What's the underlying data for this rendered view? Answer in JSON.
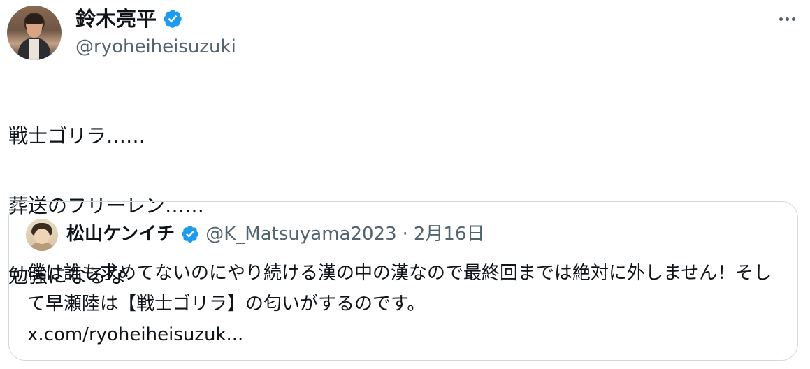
{
  "author": {
    "display_name": "鈴木亮平",
    "handle": "@ryoheiheisuzuki",
    "verified": true
  },
  "tweet": {
    "text_lines": [
      "戦士ゴリラ……",
      "葬送のフリーレン……",
      "勉強になるな"
    ]
  },
  "quoted_tweet": {
    "display_name": "松山ケンイチ",
    "verified": true,
    "handle": "@K_Matsuyama2023",
    "separator": "·",
    "date": "2月16日",
    "text": "僕は誰も求めてないのにやり続ける漢の中の漢なので最終回までは絶対に外しません！そして早瀬陸は【戦士ゴリラ】の匂いがするのです。",
    "link": "x.com/ryoheiheisuzuk..."
  },
  "icons": {
    "verified": "verified-badge-icon",
    "more": "more-horizontal-icon"
  },
  "colors": {
    "verified_blue": "#1d9bf0",
    "secondary_text": "#536471",
    "border": "#cfd9de"
  }
}
